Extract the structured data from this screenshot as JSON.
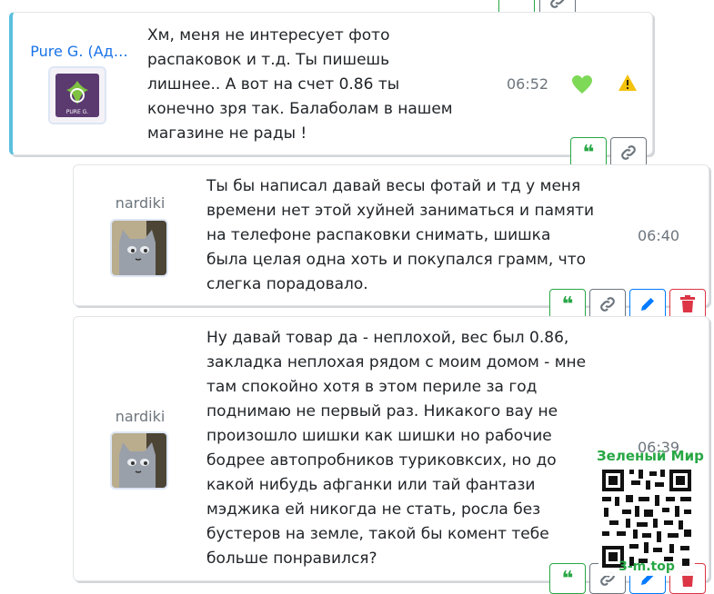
{
  "messages": [
    {
      "author": "Pure G. (Ад…",
      "text": "Хм, меня не интересует фото\nраспаковок и т.д. Ты пишешь\nлишнее.. А вот на счет 0.86 ты\nконечно зря так. Балаболам в нашем\nмагазине не рады !",
      "time": "06:52",
      "avatar_caption": "PURE G."
    },
    {
      "author": "nardiki",
      "text": "Ты бы написал давай весы фотай и тд у меня\nвремени нет этой хуйней заниматься и памяти\nна телефоне распаковки снимать, шишка\nбыла целая одна хоть и покупался грамм, что\nслегка порадовало.",
      "time": "06:40"
    },
    {
      "author": "nardiki",
      "text": "Ну давай товар да - неплохой, вес был 0.86,\nзакладка неплохая рядом с моим домом - мне\nтам спокойно хотя в этом периле за год\nподнимаю не первый раз. Никакого вау не\nпроизошло шишки как шишки но рабочие\nбодрее автопробников турикoвксих, но до\nкакой нибудь афганки или тай фантази\nмэджика ей никогда не стать, росла без\nбустеров на земле, такой бы комент тебе\nбольше понравился?",
      "time": "06:39"
    }
  ],
  "quote_glyph": "❝",
  "watermark": {
    "title": "Зеленый Мир",
    "url": "3-m.top"
  },
  "colors": {
    "quote_green": "#28a745",
    "edit_blue": "#007bff",
    "delete_red": "#dc3545",
    "admin_accent": "#5bc0de",
    "like_green": "#7ed957",
    "warning_yellow": "#f4c20d"
  }
}
